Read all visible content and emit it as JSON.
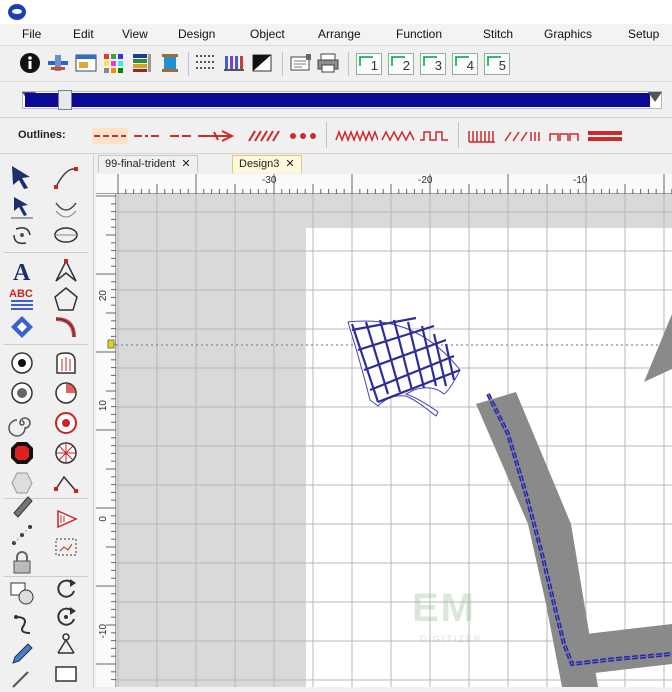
{
  "menu": [
    "File",
    "Edit",
    "View",
    "Design",
    "Object",
    "Arrange",
    "Function",
    "Stitch",
    "Graphics",
    "Setup"
  ],
  "toolbar": {
    "numbered_buttons": [
      "1",
      "2",
      "3",
      "4",
      "5"
    ]
  },
  "slider": {
    "position_fraction": 0.04
  },
  "outlines": {
    "label": "Outlines:"
  },
  "tabs": [
    {
      "label": "99-final-trident",
      "close": "✕",
      "active": false
    },
    {
      "label": "Design3",
      "close": "✕",
      "active": true
    }
  ],
  "ruler": {
    "top_labels": [
      "-30",
      "-20",
      "-10"
    ],
    "left_labels": [
      "20",
      "10",
      "0",
      "-10"
    ]
  },
  "watermark": {
    "text": "EM",
    "subtext": "DIGITIZER"
  },
  "colors": {
    "accent": "#0a0a96",
    "stitch": "#3333aa",
    "outline_red": "#cc2b2b",
    "design_gray": "#8a8a8a"
  },
  "icons": {
    "toolbar": [
      "info-icon",
      "plane-icon",
      "window-icon",
      "palette-grid-icon",
      "color-bars-icon",
      "thread-spool-icon",
      "dotted-grid-icon",
      "stitch-bars-icon",
      "contrast-icon",
      "hoop-icon",
      "print-icon",
      "view-1-icon",
      "view-2-icon",
      "view-3-icon",
      "view-4-icon",
      "view-5-icon"
    ],
    "toolbox": [
      "select-arrow-icon",
      "node-edit-icon",
      "reshape-arrow-icon",
      "arc-dots-icon",
      "rotate-icon",
      "ellipse-icon",
      "text-icon",
      "node-shape-icon",
      "lettering-icon",
      "polygon-icon",
      "diamond-icon",
      "curved-path-icon",
      "circle-target-icon",
      "fill-shape-icon",
      "radio-icon",
      "pie-shape-icon",
      "spiral-icon",
      "star-fill-icon",
      "stop-hexagon-icon",
      "radial-icon",
      "hexagon-icon",
      "angle-line-icon",
      "pen-icon",
      "triangle-fill-icon",
      "dot-path-icon",
      "dotted-box-icon",
      "lock-icon",
      "loop-icon",
      "layers-icon",
      "knot-icon",
      "pencil-icon",
      "rectangle-icon"
    ]
  }
}
